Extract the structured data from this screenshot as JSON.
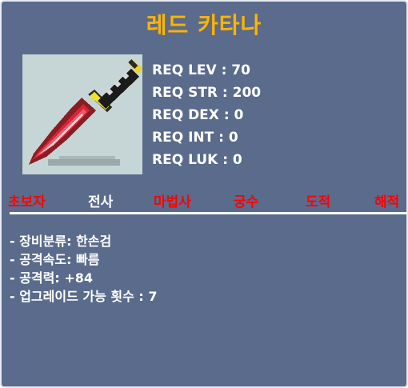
{
  "item": {
    "name": "레드 카타나",
    "icon": "red-katana-icon"
  },
  "requirements": [
    "REQ LEV : 70",
    "REQ STR : 200",
    "REQ DEX : 0",
    "REQ INT : 0",
    "REQ LUK : 0"
  ],
  "jobs": [
    {
      "label": "초보자",
      "color": "#ff0000"
    },
    {
      "label": "전사",
      "color": "#ffffff"
    },
    {
      "label": "마법사",
      "color": "#ff0000"
    },
    {
      "label": "궁수",
      "color": "#ff0000"
    },
    {
      "label": "도적",
      "color": "#ff0000"
    },
    {
      "label": "해적",
      "color": "#ff0000"
    }
  ],
  "stats": [
    "- 장비분류: 한손검",
    "- 공격속도: 빠름",
    "- 공격력: +84",
    "- 업그레이드 가능 횟수 : 7"
  ],
  "colors": {
    "panel_bg": "#5a6b8c",
    "title": "#ffb400",
    "job_available": "#ffffff",
    "job_unavailable": "#ff0000"
  }
}
